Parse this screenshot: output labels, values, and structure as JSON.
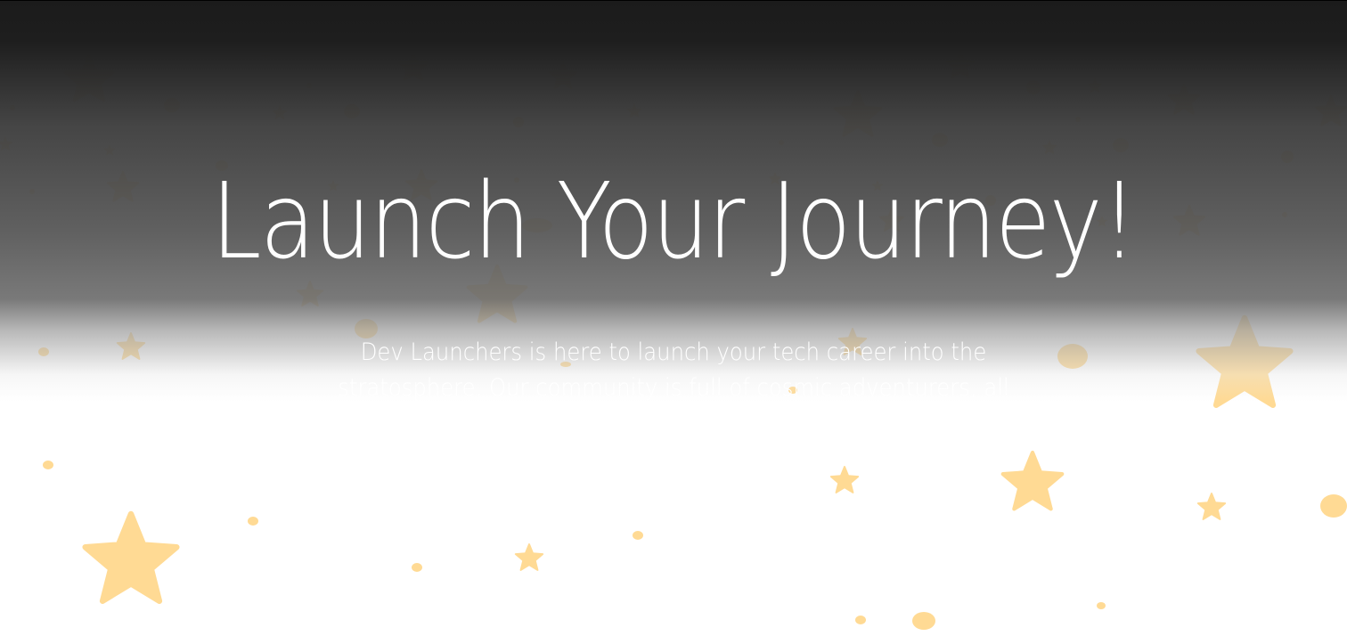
{
  "hero": {
    "headline": "Launch Your Journey!",
    "tagline": "Dev Launchers is here to launch your tech career into the stratosphere. Our community is full of cosmic adventurers, all ready",
    "star_color": "#FFDA94",
    "overlay_color": "#1b1b1b"
  }
}
